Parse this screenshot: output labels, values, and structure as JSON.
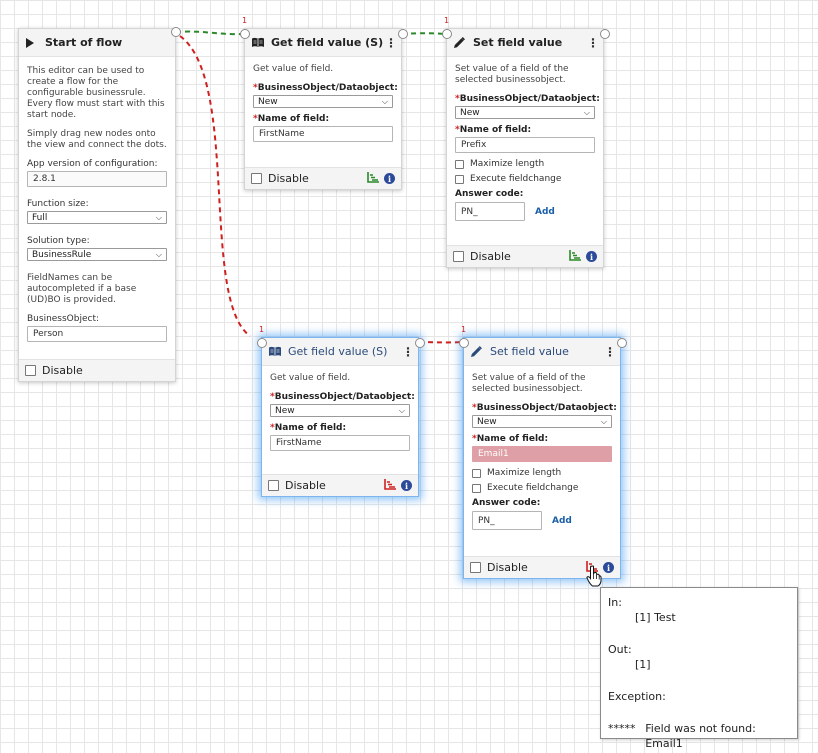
{
  "start_node": {
    "title": "Start of flow",
    "description": "This editor can be used to create a flow for the configurable businessrule. Every flow must start with this start node.",
    "hint": "Simply drag new nodes onto the view and connect the dots.",
    "app_version_label": "App version of configuration:",
    "app_version_value": "2.8.1",
    "function_size_label": "Function size:",
    "function_size_value": "Full",
    "solution_type_label": "Solution type:",
    "solution_type_value": "BusinessRule",
    "fieldnames_note": "FieldNames can be autocompleted if a base (UD)BO is provided.",
    "business_object_label": "BusinessObject:",
    "business_object_value": "Person",
    "disable_label": "Disable"
  },
  "get_node_1": {
    "title": "Get field value (S)",
    "description": "Get value of field.",
    "bo_label": "BusinessObject/Dataobject:",
    "bo_value": "New",
    "field_label": "Name of field:",
    "field_value": "FirstName",
    "disable_label": "Disable",
    "port_count": "1",
    "info_glyph": "i"
  },
  "set_node_1": {
    "title": "Set field value",
    "description": "Set value of a field of the selected businessobject.",
    "bo_label": "BusinessObject/Dataobject:",
    "bo_value": "New",
    "field_label": "Name of field:",
    "field_value": "Prefix",
    "maximize_label": "Maximize length",
    "execute_label": "Execute fieldchange",
    "answer_label": "Answer code:",
    "answer_value": "PN_",
    "add_label": "Add",
    "disable_label": "Disable",
    "port_count": "1",
    "info_glyph": "i"
  },
  "get_node_2": {
    "title": "Get field value (S)",
    "description": "Get value of field.",
    "bo_label": "BusinessObject/Dataobject:",
    "bo_value": "New",
    "field_label": "Name of field:",
    "field_value": "FirstName",
    "disable_label": "Disable",
    "port_count": "1",
    "info_glyph": "i"
  },
  "set_node_2": {
    "title": "Set field value",
    "description": "Set value of a field of the selected businessobject.",
    "bo_label": "BusinessObject/Dataobject:",
    "bo_value": "New",
    "field_label": "Name of field:",
    "field_value": "Email1",
    "maximize_label": "Maximize length",
    "execute_label": "Execute fieldchange",
    "answer_label": "Answer code:",
    "answer_value": "PN_",
    "add_label": "Add",
    "disable_label": "Disable",
    "port_count": "1",
    "info_glyph": "i"
  },
  "tooltip": {
    "in_label": "In:",
    "in_value": "[1] Test",
    "out_label": "Out:",
    "out_value": "[1]",
    "exception_label": "Exception:",
    "stars": "*****",
    "exception_message": "Field was not found: Email1"
  },
  "required_marker": "*",
  "menu_glyph": "⋮",
  "chevron_glyph": "⌵",
  "colors": {
    "success_edge": "#2a8a2a",
    "error_edge": "#d02020",
    "error_input": "#dea0a6",
    "selected_glow": "#3c96f0",
    "info_badge": "#2c4a9a",
    "link": "#1a5fa8"
  }
}
